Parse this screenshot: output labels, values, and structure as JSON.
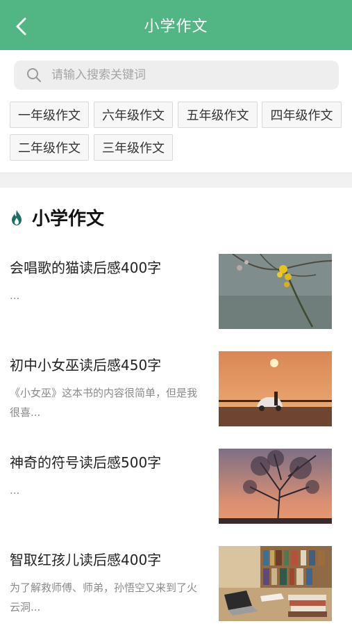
{
  "header": {
    "title": "小学作文",
    "back_icon": "chevron-left-icon"
  },
  "search": {
    "placeholder": "请输入搜索关键词",
    "icon": "search-icon"
  },
  "grades": [
    "一年级作文",
    "六年级作文",
    "五年级作文",
    "四年级作文",
    "二年级作文",
    "三年级作文"
  ],
  "section": {
    "title": "小学作文",
    "icon": "flame-icon"
  },
  "articles": [
    {
      "title": "会唱歌的猫读后感400字",
      "summary": "...",
      "thumb": "yellow-flower-branch"
    },
    {
      "title": "初中小女巫读后感450字",
      "summary": "《小女巫》这本书的内容很简单，但是我很喜...",
      "thumb": "sunset-car"
    },
    {
      "title": "神奇的符号读后感500字",
      "summary": "...",
      "thumb": "tree-silhouette-dusk"
    },
    {
      "title": "智取红孩儿读后感400字",
      "summary": "为了解救师傅、师弟，孙悟空又来到了火云洞...",
      "thumb": "library-desk"
    }
  ],
  "colors": {
    "accent": "#52b584"
  }
}
